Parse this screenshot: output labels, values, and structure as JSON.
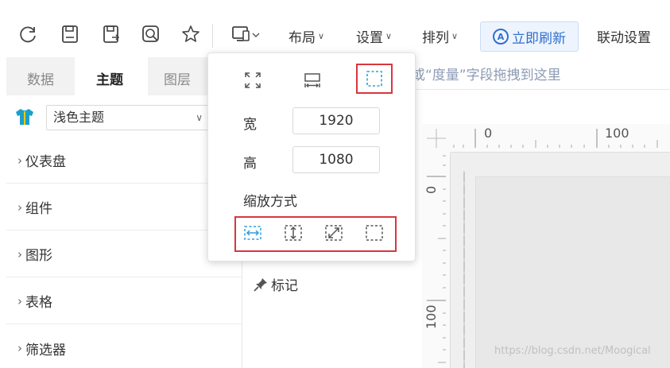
{
  "toolbar": {
    "icons": [
      "refresh-icon",
      "save-icon",
      "save-as-icon",
      "preview-icon",
      "star-icon",
      "device-icon"
    ],
    "menus": {
      "layout": "布局",
      "settings": "设置",
      "arrange": "排列",
      "refresh": "立即刷新",
      "linkage": "联动设置"
    },
    "refresh_icon_letter": "A"
  },
  "left_panel": {
    "tabs": [
      "数据",
      "主题",
      "图层"
    ],
    "active_tab": "主题",
    "theme_select": "浅色主题",
    "categories": [
      "仪表盘",
      "组件",
      "图形",
      "表格",
      "筛选器"
    ]
  },
  "main": {
    "field_hint": "或“度量”字段拖拽到这里",
    "mark_label": "标记"
  },
  "canvas": {
    "h_ruler_labels": [
      "0",
      "100"
    ],
    "v_ruler_labels": [
      "0",
      "100"
    ],
    "watermark": "https://blog.csdn.net/Moogical"
  },
  "popup": {
    "width_label": "宽",
    "width_value": "1920",
    "height_label": "高",
    "height_value": "1080",
    "scale_mode_label": "缩放方式",
    "accent_color": "#2f9fd8",
    "highlight_color": "#d9363e"
  }
}
